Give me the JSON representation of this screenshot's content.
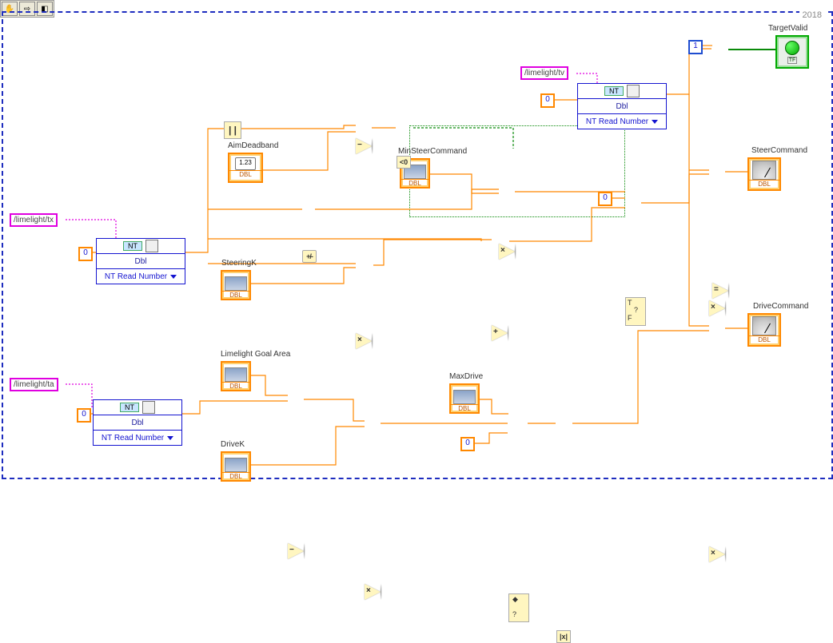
{
  "toolbar": {
    "hand": "✋",
    "arrow": "⇨",
    "stop": "◧"
  },
  "frame_year": "2018",
  "strings": {
    "tv": "/limelight/tv",
    "tx": "/limelight/tx",
    "ta": "/limelight/ta"
  },
  "nt": {
    "nt_tag": "NT",
    "dbl": "Dbl",
    "title": "NT Read Number"
  },
  "const": {
    "zero": "0",
    "one": "1"
  },
  "labels": {
    "AimDeadband": "AimDeadband",
    "MinSteerCommand": "MinSteerCommand",
    "SteeringK": "SteeringK",
    "LimelightGoalArea": "Limelight Goal Area",
    "MaxDrive": "MaxDrive",
    "DriveK": "DriveK",
    "TargetValid": "TargetValid",
    "SteerCommand": "SteerCommand",
    "DriveCommand": "DriveCommand"
  },
  "ctl": {
    "axis": "0  5  10",
    "dbl": "DBL",
    "num": "1.23",
    "tf": "TF"
  },
  "ops": {
    "abs": "| |",
    "sub": "−",
    "lt0": "<0",
    "eq": "=",
    "mul": "×",
    "add": "+",
    "sign": "+/-",
    "absval": "|x|"
  },
  "sel": {
    "q": "?",
    "t": "T",
    "f": "F",
    "d": "◆"
  }
}
